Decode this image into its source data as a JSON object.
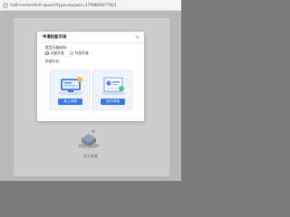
{
  "browser": {
    "url": "/skill-center/skill-square?type=bypass=1758606077921"
  },
  "background": {
    "caption": "暂无数据"
  },
  "modal": {
    "title": "申请技能市场",
    "close_label": "×",
    "question_label": "是否开放给你:",
    "options": [
      {
        "label": "内部开放",
        "checked": true
      },
      {
        "label": "外部开放",
        "checked": false
      }
    ],
    "method_label": "申请方式:",
    "cards": [
      {
        "button_label": "新上申请",
        "icon": "monitor-illustration-icon"
      },
      {
        "button_label": "旧子申请",
        "icon": "profile-card-illustration-icon"
      }
    ]
  },
  "colors": {
    "accent": "#3c78e8",
    "overlay": "#b8b8b8",
    "card_bg": "#eef3fc"
  }
}
